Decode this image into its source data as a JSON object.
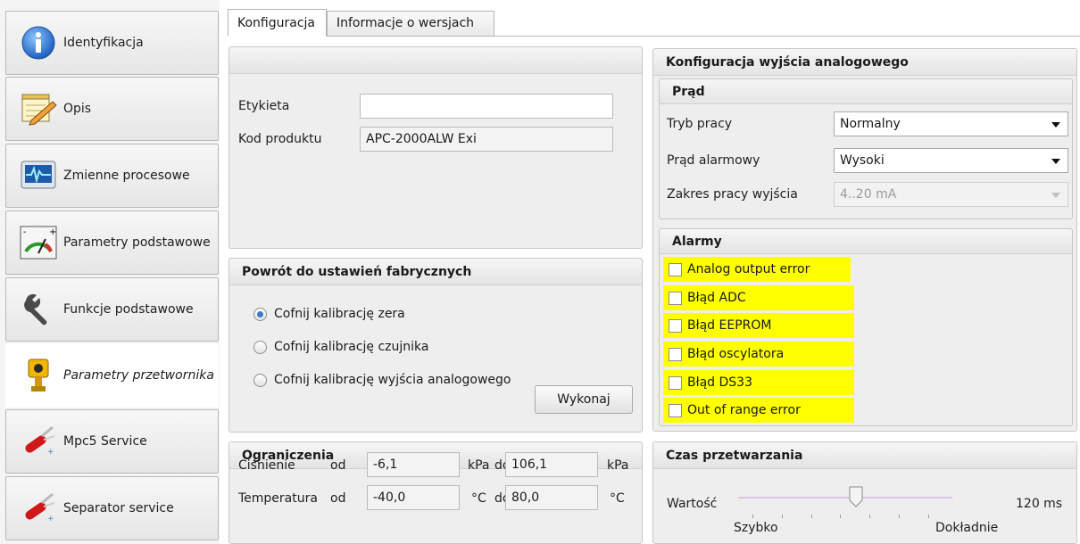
{
  "sidebar": {
    "items": [
      {
        "label": "Identyfikacja",
        "icon": "info-icon"
      },
      {
        "label": "Opis",
        "icon": "notepad-pencil-icon"
      },
      {
        "label": "Zmienne procesowe",
        "icon": "monitor-waveform-icon"
      },
      {
        "label": "Parametry podstawowe",
        "icon": "gauge-icon"
      },
      {
        "label": "Funkcje podstawowe",
        "icon": "wrench-icon"
      },
      {
        "label": "Parametry przetwornika",
        "icon": "transmitter-icon",
        "active": true
      },
      {
        "label": "Mpc5 Service",
        "icon": "swiss-knife-icon"
      },
      {
        "label": "Separator service",
        "icon": "swiss-knife-icon"
      }
    ]
  },
  "tabs": [
    {
      "label": "Konfiguracja",
      "active": true
    },
    {
      "label": "Informacje o wersjach",
      "active": false
    }
  ],
  "identity": {
    "etykieta_label": "Etykieta",
    "etykieta_value": "",
    "kod_label": "Kod produktu",
    "kod_value": "APC-2000ALW Exi"
  },
  "factory": {
    "title": "Powrót do ustawień fabrycznych",
    "options": [
      {
        "label": "Cofnij kalibrację zera",
        "checked": true
      },
      {
        "label": "Cofnij kalibrację czujnika",
        "checked": false
      },
      {
        "label": "Cofnij kalibrację wyjścia analogowego",
        "checked": false
      }
    ],
    "execute_label": "Wykonaj"
  },
  "limits": {
    "title": "Ograniczenia",
    "od_label": "od",
    "do_label": "do",
    "pressure": {
      "label": "Ciśnienie",
      "from": "-6,1",
      "to": "106,1",
      "unit_from": "kPa",
      "unit_to": "kPa"
    },
    "temperature": {
      "label": "Temperatura",
      "from": "-40,0",
      "to": "80,0",
      "unit_from": "°C",
      "unit_to": "°C"
    }
  },
  "analog": {
    "title": "Konfiguracja wyjścia analogowego",
    "current_title": "Prąd",
    "mode_label": "Tryb pracy",
    "mode_value": "Normalny",
    "alarm_current_label": "Prąd alarmowy",
    "alarm_current_value": "Wysoki",
    "range_label": "Zakres pracy wyjścia",
    "range_value": "4..20 mA"
  },
  "alarms": {
    "title": "Alarmy",
    "highlight_color": "#ffff00",
    "items": [
      {
        "label": "Analog output error",
        "checked": false
      },
      {
        "label": "Błąd ADC",
        "checked": false
      },
      {
        "label": "Błąd EEPROM",
        "checked": false
      },
      {
        "label": "Błąd oscylatora",
        "checked": false
      },
      {
        "label": "Błąd DS33",
        "checked": false
      },
      {
        "label": "Out of range error",
        "checked": false
      }
    ]
  },
  "processing": {
    "title": "Czas przetwarzania",
    "value_label": "Wartość",
    "value": "120 ms",
    "slider_level": 0.55,
    "min_label": "Szybko",
    "max_label": "Dokładnie"
  }
}
